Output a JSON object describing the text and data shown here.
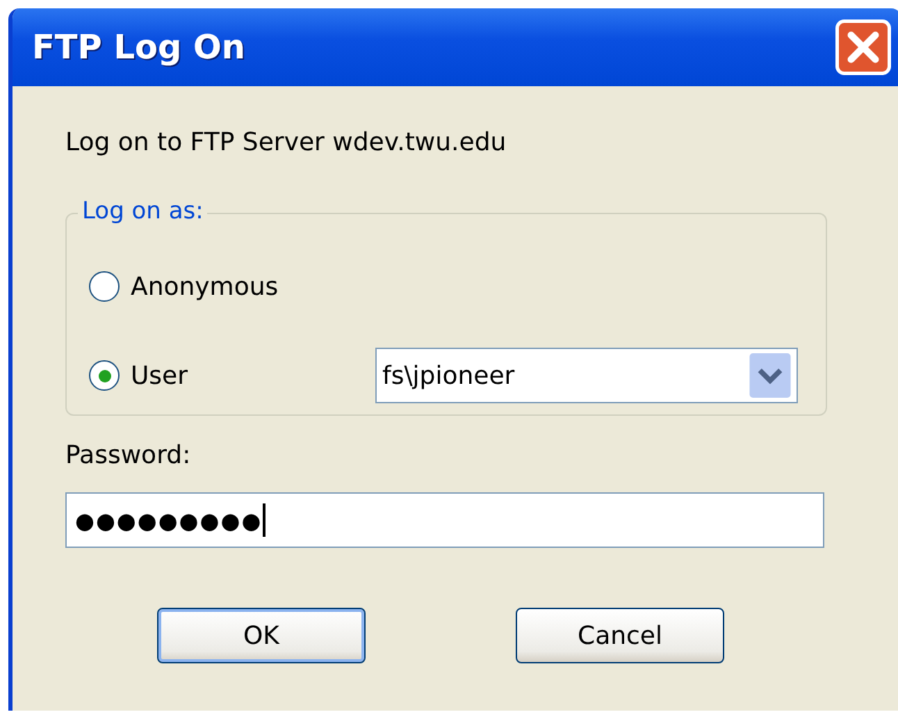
{
  "window": {
    "title": "FTP Log On"
  },
  "message": "Log on to FTP Server wdev.twu.edu",
  "group": {
    "label": "Log on as:",
    "options": [
      {
        "label": "Anonymous",
        "selected": false
      },
      {
        "label": "User",
        "selected": true
      }
    ],
    "user_combo": {
      "value": "fs\\jpioneer"
    }
  },
  "password": {
    "label": "Password:",
    "value": "●●●●●●●●●"
  },
  "buttons": [
    {
      "label": "OK",
      "default": true
    },
    {
      "label": "Cancel",
      "default": false
    }
  ]
}
